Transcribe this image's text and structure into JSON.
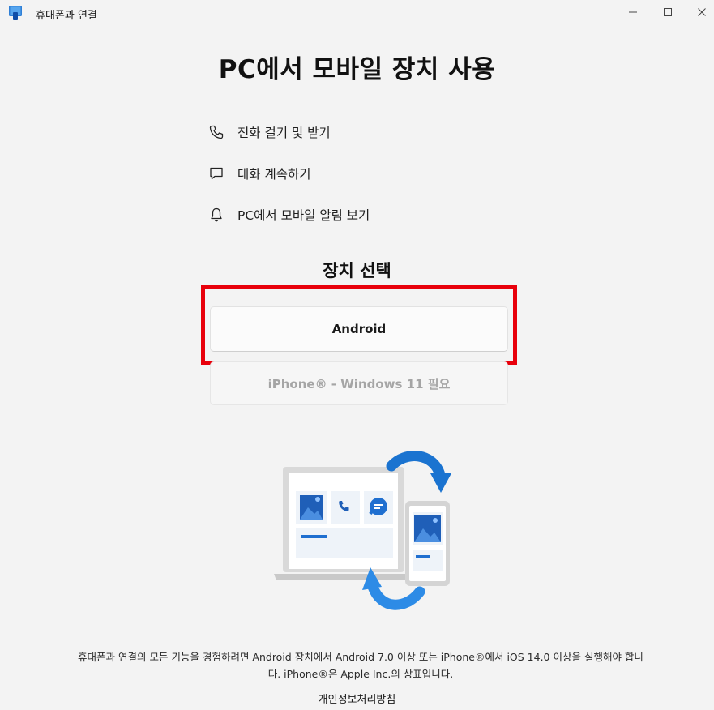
{
  "window": {
    "title": "휴대폰과 연결",
    "controls": {
      "minimize": "minimize-icon",
      "maximize": "maximize-icon",
      "close": "close-icon"
    }
  },
  "main": {
    "heading": "PC에서 모바일 장치 사용",
    "features": [
      {
        "icon": "phone-icon",
        "label": "전화 걸기 및 받기"
      },
      {
        "icon": "chat-bubble-icon",
        "label": "대화 계속하기"
      },
      {
        "icon": "bell-icon",
        "label": "PC에서 모바일 알림 보기"
      }
    ],
    "device_select_title": "장치 선택",
    "android_button": "Android",
    "iphone_button": "iPhone® - Windows 11 필요",
    "footnote_line1": "휴대폰과 연결의 모든 기능을 경험하려면 Android 장치에서 Android 7.0 이상 또는 iPhone®에서 iOS 14.0 이상을 실행해야 합니",
    "footnote_line2": "다. iPhone®은 Apple Inc.의 상표입니다.",
    "privacy_link": "개인정보처리방침"
  },
  "colors": {
    "accent_blue": "#0f78d4",
    "highlight_red": "#e8000b",
    "background": "#f3f3f3"
  }
}
